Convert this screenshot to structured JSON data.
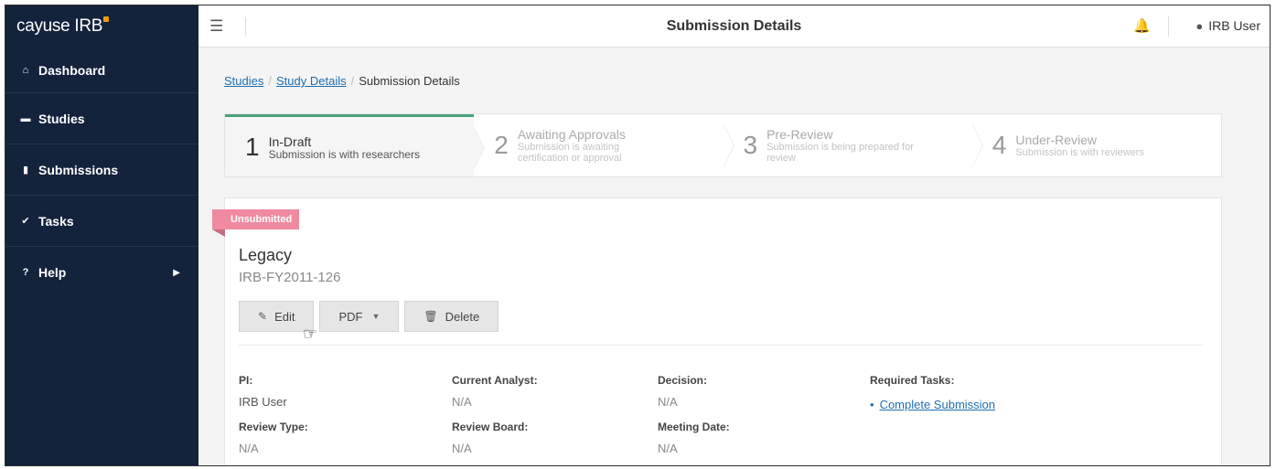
{
  "brand": {
    "name": "cayuse IRB",
    "accent": "#f39c12"
  },
  "sidebar": {
    "items": [
      {
        "icon": "home-icon",
        "glyph": "⌂",
        "label": "Dashboard"
      },
      {
        "icon": "folder-icon",
        "glyph": "▬",
        "label": "Studies"
      },
      {
        "icon": "file-icon",
        "glyph": "▮",
        "label": "Submissions"
      },
      {
        "icon": "check-icon",
        "glyph": "✔",
        "label": "Tasks"
      },
      {
        "icon": "question-icon",
        "glyph": "?",
        "label": "Help"
      }
    ]
  },
  "topbar": {
    "title": "Submission Details",
    "user": "IRB User"
  },
  "breadcrumb": {
    "studies": "Studies",
    "study_details": "Study Details",
    "current": "Submission Details"
  },
  "steps": [
    {
      "num": "1",
      "title": "In-Draft",
      "subtitle": "Submission is with researchers",
      "active": true
    },
    {
      "num": "2",
      "title": "Awaiting Approvals",
      "subtitle": "Submission is awaiting certification or approval",
      "active": false
    },
    {
      "num": "3",
      "title": "Pre-Review",
      "subtitle": "Submission is being prepared for review",
      "active": false
    },
    {
      "num": "4",
      "title": "Under-Review",
      "subtitle": "Submission is with reviewers",
      "active": false
    }
  ],
  "card": {
    "status": "Unsubmitted",
    "title": "Legacy",
    "id": "IRB-FY2011-126",
    "buttons": {
      "edit": "Edit",
      "pdf": "PDF",
      "delete": "Delete"
    },
    "fields": {
      "pi_label": "PI:",
      "pi_value": "IRB User",
      "analyst_label": "Current Analyst:",
      "analyst_value": "N/A",
      "decision_label": "Decision:",
      "decision_value": "N/A",
      "tasks_label": "Required Tasks:",
      "task_1": "Complete Submission",
      "review_type_label": "Review Type:",
      "review_type_value": "N/A",
      "board_label": "Review Board:",
      "board_value": "N/A",
      "meeting_label": "Meeting Date:",
      "meeting_value": "N/A"
    }
  },
  "colors": {
    "sidebar_bg": "#14233c",
    "active_step_border": "#4aa07a",
    "ribbon": "#f08aa0",
    "link": "#1f6fb2"
  }
}
